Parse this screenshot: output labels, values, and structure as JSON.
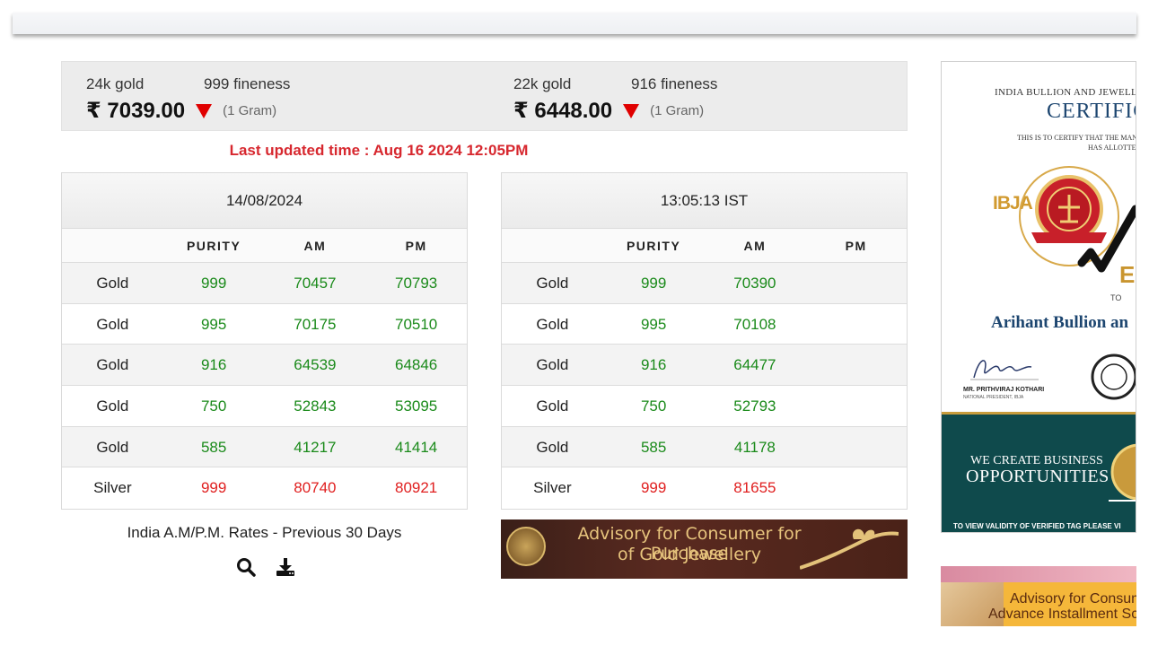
{
  "rate_header": {
    "gold24": {
      "karat": "24k gold",
      "fineness": "999 fineness",
      "price": "₹ 7039.00",
      "unit": "(1 Gram)"
    },
    "gold22": {
      "karat": "22k gold",
      "fineness": "916 fineness",
      "price": "₹ 6448.00",
      "unit": "(1 Gram)"
    }
  },
  "last_updated": "Last updated time : Aug 16 2024 12:05PM",
  "table_left": {
    "title": "14/08/2024",
    "headers": [
      "",
      "PURITY",
      "AM",
      "PM"
    ],
    "rows": [
      {
        "metal": "Gold",
        "purity": "999",
        "am": "70457",
        "pm": "70793"
      },
      {
        "metal": "Gold",
        "purity": "995",
        "am": "70175",
        "pm": "70510"
      },
      {
        "metal": "Gold",
        "purity": "916",
        "am": "64539",
        "pm": "64846"
      },
      {
        "metal": "Gold",
        "purity": "750",
        "am": "52843",
        "pm": "53095"
      },
      {
        "metal": "Gold",
        "purity": "585",
        "am": "41217",
        "pm": "41414"
      },
      {
        "metal": "Silver",
        "purity": "999",
        "am": "80740",
        "pm": "80921"
      }
    ]
  },
  "table_right": {
    "title": "13:05:13 IST",
    "headers": [
      "",
      "PURITY",
      "AM",
      "PM"
    ],
    "rows": [
      {
        "metal": "Gold",
        "purity": "999",
        "am": "70390",
        "pm": ""
      },
      {
        "metal": "Gold",
        "purity": "995",
        "am": "70108",
        "pm": ""
      },
      {
        "metal": "Gold",
        "purity": "916",
        "am": "64477",
        "pm": ""
      },
      {
        "metal": "Gold",
        "purity": "750",
        "am": "52793",
        "pm": ""
      },
      {
        "metal": "Gold",
        "purity": "585",
        "am": "41178",
        "pm": ""
      },
      {
        "metal": "Silver",
        "purity": "999",
        "am": "81655",
        "pm": ""
      }
    ]
  },
  "previous_rates": {
    "label": "India A.M/P.M. Rates - Previous 30 Days",
    "icons": [
      "search-icon",
      "download-icon"
    ]
  },
  "advisory_banner": {
    "line1": "Advisory for Consumer for Purchase",
    "line2": "of Gold Jewellery"
  },
  "certificate_ad": {
    "org": "INDIA BULLION AND JEWELLEF",
    "title": "CERTIFIC",
    "line1": "THIS IS TO CERTIFY THAT THE MAN.",
    "line2": "HAS ALLOTTEI",
    "logo_text": "IBJA",
    "to": "TO",
    "recipient": "Arihant Bullion an",
    "signer": "MR. PRITHVIRAJ KOTHARI",
    "signer_role": "NATIONAL PRESIDENT, IBJA",
    "tagline1": "WE CREATE BUSINESS",
    "tagline2": "OPPORTUNITIES",
    "validity": "TO VIEW VALIDITY OF VERIFIED TAG PLEASE VI"
  },
  "advisory_ad2": {
    "line1": "Advisory for Consum",
    "line2": "Advance Installment Sch"
  },
  "colors": {
    "down": "#e00000",
    "updated": "#d7282f",
    "gold_value": "#1a8a1a",
    "silver_value": "#e02020"
  }
}
